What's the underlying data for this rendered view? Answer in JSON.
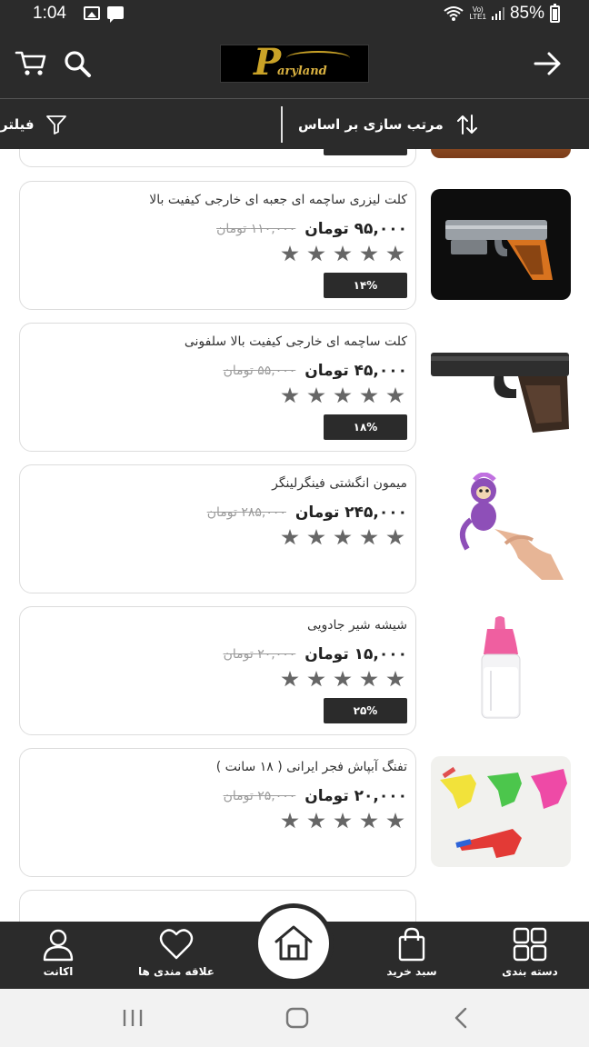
{
  "status_bar": {
    "time": "1:04",
    "lte_label": "Vo)\nLTE1",
    "battery": "85%"
  },
  "header": {
    "logo_text": "aryland",
    "logo_letter": "P"
  },
  "toolbar": {
    "sort_label": "مرتب سازی بر اساس",
    "filter_label": "فیلتر"
  },
  "products": [
    {
      "title": "کلت لیزری ساچمه ای جعبه ای خارجی کیفیت بالا",
      "old_price": "۱۱۰,۰۰۰ تومان",
      "new_price": "۹۵,۰۰۰ تومان",
      "rating": 5,
      "discount": "۱۴%"
    },
    {
      "title": "کلت ساچمه ای خارجی کیفیت بالا سلفونی",
      "old_price": "۵۵,۰۰۰ تومان",
      "new_price": "۴۵,۰۰۰ تومان",
      "rating": 5,
      "discount": "۱۸%"
    },
    {
      "title": "میمون انگشتی فینگرلینگر",
      "old_price": "۲۸۵,۰۰۰ تومان",
      "new_price": "۲۴۵,۰۰۰ تومان",
      "rating": 5,
      "discount": ""
    },
    {
      "title": "شیشه شیر جادویی",
      "old_price": "۲۰,۰۰۰ تومان",
      "new_price": "۱۵,۰۰۰ تومان",
      "rating": 5,
      "discount": "۲۵%"
    },
    {
      "title": "تفنگ آبپاش فجر ایرانی ( ۱۸ سانت )",
      "old_price": "۲۵,۰۰۰ تومان",
      "new_price": "۲۰,۰۰۰ تومان",
      "rating": 5,
      "discount": ""
    }
  ],
  "bottom_nav": {
    "account": "اکانت",
    "wishlist": "علاقه مندی ها",
    "cart": "سبد خرید",
    "categories": "دسته بندی"
  },
  "colors": {
    "dark": "#2b2b2b",
    "star": "#666666",
    "old_price": "#9b9b9b"
  }
}
